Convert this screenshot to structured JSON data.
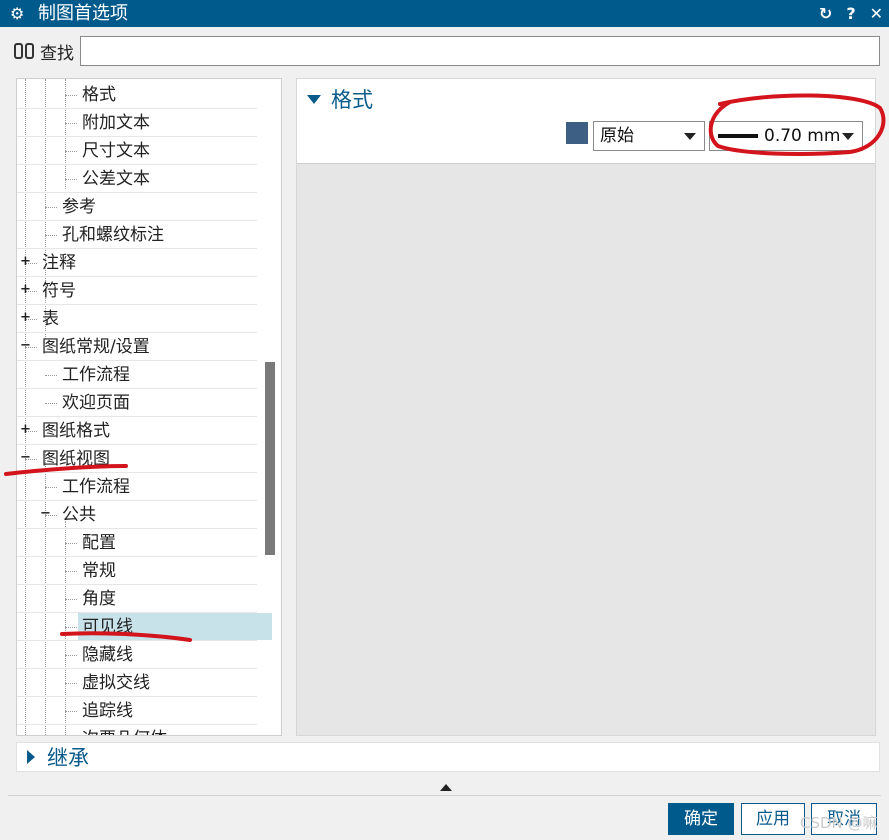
{
  "window": {
    "title": "制图首选项",
    "reset_icon": "↻",
    "help_icon": "?",
    "close_icon": "✕"
  },
  "search": {
    "label": "查找",
    "value": ""
  },
  "tree": {
    "items": [
      {
        "label": "格式",
        "level": 3,
        "expander": ""
      },
      {
        "label": "附加文本",
        "level": 3,
        "expander": ""
      },
      {
        "label": "尺寸文本",
        "level": 3,
        "expander": ""
      },
      {
        "label": "公差文本",
        "level": 3,
        "expander": ""
      },
      {
        "label": "参考",
        "level": 2,
        "expander": ""
      },
      {
        "label": "孔和螺纹标注",
        "level": 2,
        "expander": ""
      },
      {
        "label": "注释",
        "level": 1,
        "expander": "+"
      },
      {
        "label": "符号",
        "level": 1,
        "expander": "+"
      },
      {
        "label": "表",
        "level": 1,
        "expander": "+"
      },
      {
        "label": "图纸常规/设置",
        "level": 1,
        "expander": "−"
      },
      {
        "label": "工作流程",
        "level": 2,
        "expander": ""
      },
      {
        "label": "欢迎页面",
        "level": 2,
        "expander": ""
      },
      {
        "label": "图纸格式",
        "level": 1,
        "expander": "+"
      },
      {
        "label": "图纸视图",
        "level": 1,
        "expander": "−"
      },
      {
        "label": "工作流程",
        "level": 2,
        "expander": ""
      },
      {
        "label": "公共",
        "level": 2,
        "expander": "−"
      },
      {
        "label": "配置",
        "level": 3,
        "expander": ""
      },
      {
        "label": "常规",
        "level": 3,
        "expander": ""
      },
      {
        "label": "角度",
        "level": 3,
        "expander": ""
      },
      {
        "label": "可见线",
        "level": 3,
        "expander": "",
        "selected": true
      },
      {
        "label": "隐藏线",
        "level": 3,
        "expander": ""
      },
      {
        "label": "虚拟交线",
        "level": 3,
        "expander": ""
      },
      {
        "label": "追踪线",
        "level": 3,
        "expander": ""
      },
      {
        "label": "次要几何体",
        "level": 3,
        "expander": ""
      }
    ]
  },
  "format_section": {
    "title": "格式",
    "color_swatch": "#3e5f84",
    "line_style": "原始",
    "line_width": "0.70 mm"
  },
  "inherit_section": {
    "title": "继承"
  },
  "buttons": {
    "ok": "确定",
    "apply": "应用",
    "cancel": "取消"
  },
  "watermark": "CSDN @嘛",
  "colors": {
    "titlebar": "#005a8c",
    "accent": "#0a5b8c",
    "selection": "#c8e2ea",
    "annotation": "#d4141c"
  }
}
